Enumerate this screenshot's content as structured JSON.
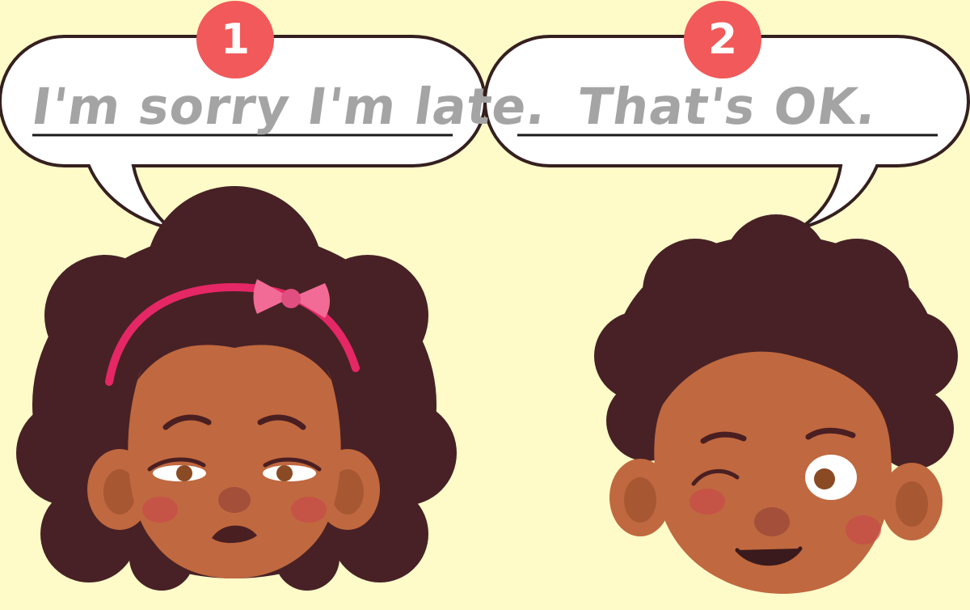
{
  "colors": {
    "background": "#fefbc9",
    "bubble_fill": "#ffffff",
    "bubble_outline": "#35201f",
    "badge": "#f1595a",
    "answer_text": "#a4a4a4",
    "hair": "#472125",
    "skin": "#c0683f",
    "headband": "#e52766"
  },
  "dialogue": [
    {
      "number": "1",
      "speaker": "girl",
      "text": "I'm sorry I'm late."
    },
    {
      "number": "2",
      "speaker": "boy",
      "text": "That's OK."
    }
  ]
}
